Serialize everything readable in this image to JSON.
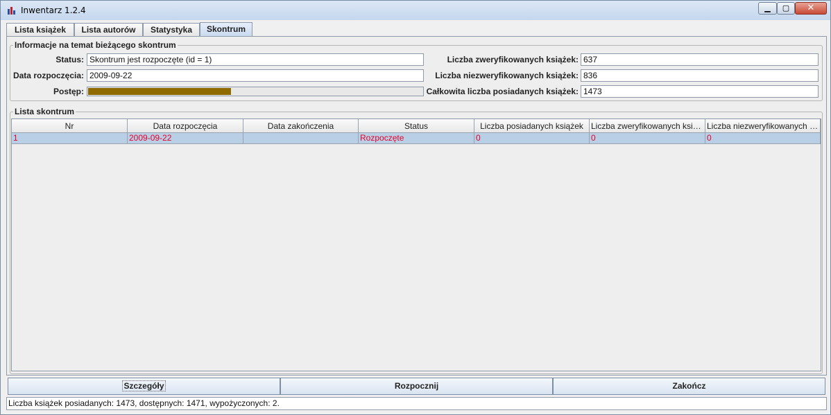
{
  "window": {
    "title": "Inwentarz 1.2.4"
  },
  "tabs": [
    {
      "label": "Lista książek"
    },
    {
      "label": "Lista autorów"
    },
    {
      "label": "Statystyka"
    },
    {
      "label": "Skontrum"
    }
  ],
  "active_tab": "Skontrum",
  "info": {
    "legend": "Informacje na temat bieżącego skontrum",
    "status_label": "Status:",
    "status_value": "Skontrum jest rozpoczęte (id = 1)",
    "start_label": "Data rozpoczęcia:",
    "start_value": "2009-09-22",
    "progress_label": "Postęp:",
    "progress_fraction": 0.43,
    "verified_label": "Liczba zweryfikowanych książek:",
    "verified_value": "637",
    "unverified_label": "Liczba niezweryfikowanych książek:",
    "unverified_value": "836",
    "total_label": "Całkowita liczba posiadanych książek:",
    "total_value": "1473",
    "progress_color": "#8f6a00"
  },
  "list": {
    "legend": "Lista skontrum",
    "columns": [
      "Nr",
      "Data rozpoczęcia",
      "Data zakończenia",
      "Status",
      "Liczba posiadanych książek",
      "Liczba zweryfikowanych ksią...",
      "Liczba niezweryfikowanych k..."
    ],
    "rows": [
      [
        "1",
        "2009-09-22",
        "",
        "Rozpoczęte",
        "0",
        "0",
        "0"
      ]
    ],
    "row_text_color": "#e8002a",
    "selected_row_color": "#b8cfe5"
  },
  "buttons": {
    "details": "Szczegóły",
    "start": "Rozpocznij",
    "finish": "Zakończ"
  },
  "status_bar": "Liczba książek posiadanych: 1473, dostępnych: 1471, wypożyczonych: 2."
}
